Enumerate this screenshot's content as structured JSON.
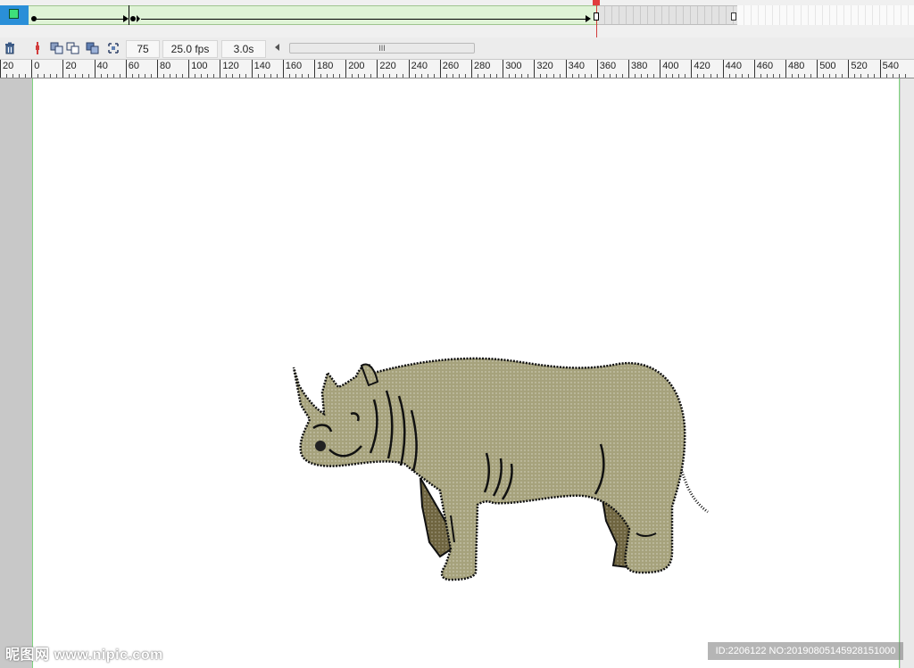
{
  "timeline": {
    "current_frame": "75",
    "fps": "25.0 fps",
    "elapsed": "3.0s",
    "scroll_thumb_glyph": "III"
  },
  "ruler": {
    "labels": [
      "20",
      "0",
      "20",
      "40",
      "60",
      "80",
      "100",
      "120",
      "140",
      "160",
      "180",
      "200",
      "220",
      "240",
      "260",
      "280",
      "300",
      "320",
      "340",
      "360",
      "380",
      "400",
      "420",
      "440",
      "460",
      "480",
      "500",
      "520",
      "540"
    ]
  },
  "watermark": {
    "left_text": "昵图网 www.nipic.com",
    "right_text": "ID:2206122 NO:20190805145928151000"
  },
  "icons": {
    "trash": "trash-icon",
    "onion_skin": "onion-skin-icon",
    "onion_outline": "onion-outline-icon",
    "edit_multiple": "edit-multiple-frames-icon",
    "modify_markers": "modify-markers-icon",
    "center_frame": "center-frame-icon"
  },
  "colors": {
    "layer_highlight": "#2a8fd8",
    "tween_fill": "#dff3d6",
    "playhead": "#e03c3c",
    "rhino_body": "#a6a27c",
    "rhino_shadow": "#6f6540",
    "stage_border": "#7fd47f"
  }
}
